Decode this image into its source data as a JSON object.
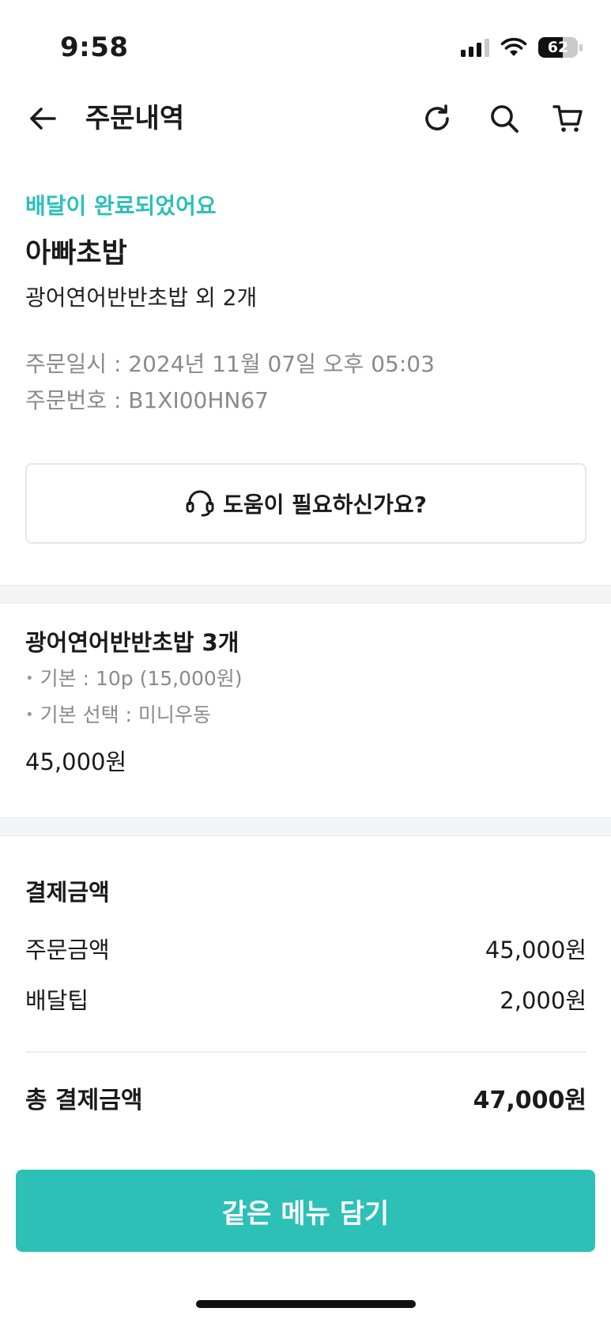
{
  "status_bar": {
    "time": "9:58",
    "battery_level": "62",
    "icons": [
      "cellular-signal-icon",
      "wifi-icon",
      "battery-icon"
    ]
  },
  "header": {
    "title": "주문내역",
    "icons": [
      "back-arrow-icon",
      "refresh-icon",
      "search-icon",
      "cart-icon"
    ]
  },
  "order": {
    "status": "배달이 완료되었어요",
    "store": "아빠초밥",
    "items_summary": "광어연어반반초밥 외 2개",
    "date_line": "주문일시 : 2024년 11월 07일 오후 05:03",
    "number_line": "주문번호 : B1XI00HN67"
  },
  "help": {
    "label": "도움이 필요하신가요?",
    "icon": "headset-icon"
  },
  "menu_item": {
    "name": "광어연어반반초밥 3개",
    "options": [
      "기본 : 10p (15,000원)",
      "기본 선택 : 미니우동"
    ],
    "price": "45,000원"
  },
  "payment": {
    "title": "결제금액",
    "rows": [
      {
        "label": "주문금액",
        "value": "45,000원"
      },
      {
        "label": "배달팁",
        "value": "2,000원"
      }
    ],
    "total_label": "총 결제금액",
    "total_value": "47,000원"
  },
  "actions": {
    "reorder_label": "같은 메뉴 담기"
  },
  "colors": {
    "accent": "#2cc0b7",
    "text": "#1a1a1a",
    "muted": "#8a8a8a",
    "band": "#f3f4f6"
  }
}
